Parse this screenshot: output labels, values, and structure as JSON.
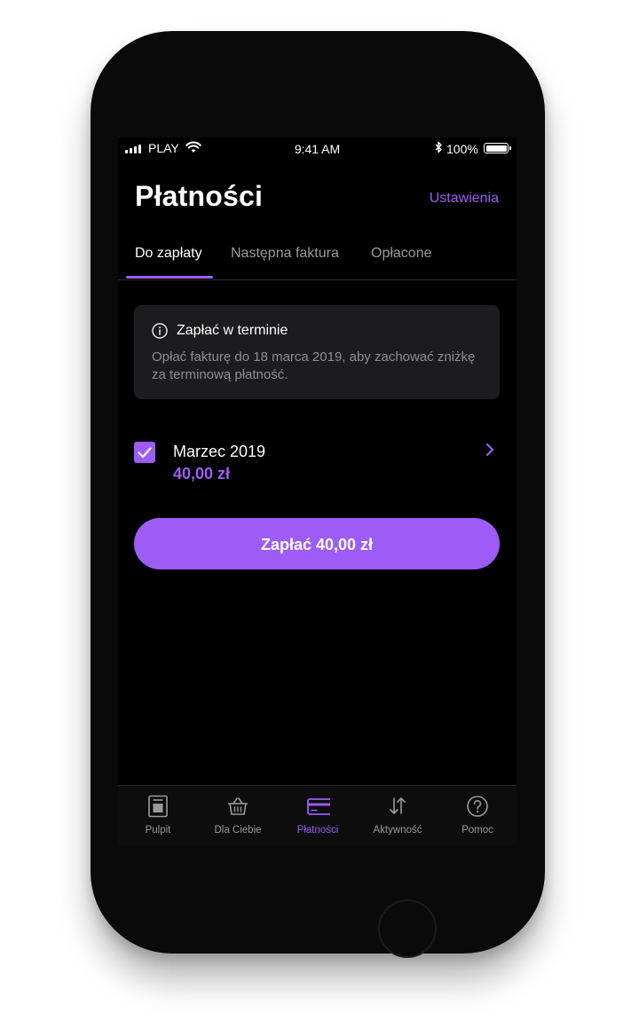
{
  "status_bar": {
    "carrier": "PLAY",
    "time": "9:41 AM",
    "battery": "100%"
  },
  "header": {
    "title": "Płatności",
    "settings_label": "Ustawienia"
  },
  "tabs": [
    {
      "label": "Do zapłaty",
      "active": true
    },
    {
      "label": "Następna faktura",
      "active": false
    },
    {
      "label": "Opłacone",
      "active": false
    }
  ],
  "info_card": {
    "icon": "info-icon",
    "title": "Zapłać w terminie",
    "text": "Opłać fakturę do 18 marca 2019, aby zachować zniżkę za terminową płatność."
  },
  "invoice": {
    "title": "Marzec 2019",
    "amount": "40,00 zł",
    "checked": true
  },
  "pay_button": {
    "label": "Zapłać 40,00 zł"
  },
  "bottom_nav": [
    {
      "label": "Pulpit",
      "icon": "dashboard-icon",
      "active": false
    },
    {
      "label": "Dla Ciebie",
      "icon": "basket-icon",
      "active": false
    },
    {
      "label": "Płatności",
      "icon": "credit-card-icon",
      "active": true
    },
    {
      "label": "Aktywność",
      "icon": "arrows-updown-icon",
      "active": false
    },
    {
      "label": "Pomoc",
      "icon": "help-icon",
      "active": false
    }
  ],
  "colors": {
    "accent": "#9d5cf6",
    "background": "#000000",
    "card": "#1c1c1e",
    "muted_text": "#8e8e93"
  }
}
